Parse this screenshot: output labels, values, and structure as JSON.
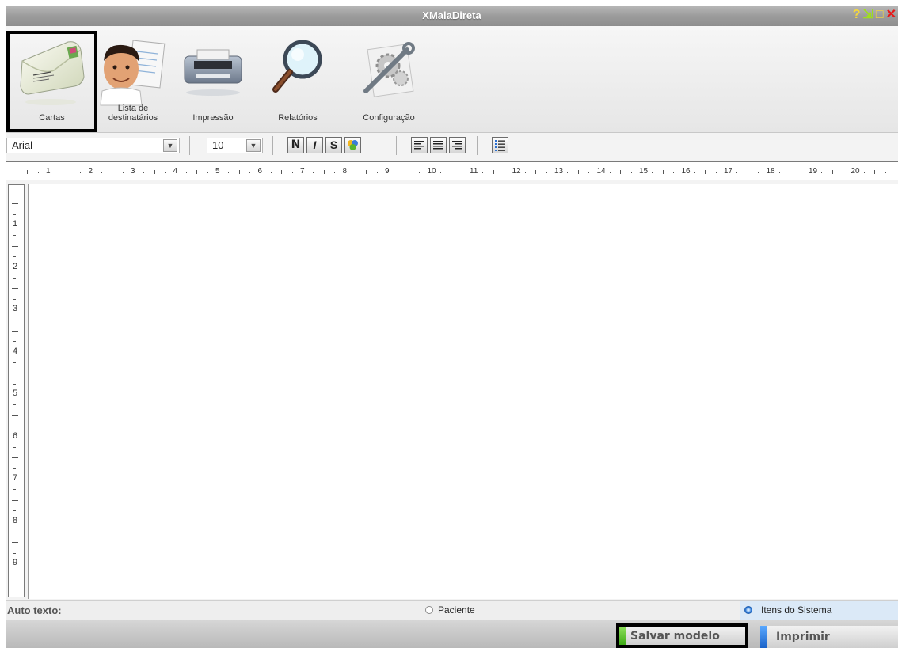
{
  "window": {
    "title": "XMalaDireta"
  },
  "ribbon": {
    "items": [
      {
        "label": "Cartas",
        "icon": "envelope-icon",
        "selected": true
      },
      {
        "label_line1": "Lista de",
        "label_line2": "destinatários",
        "icon": "person-list-icon"
      },
      {
        "label": "Impressão",
        "icon": "printer-icon"
      },
      {
        "label": "Relatórios",
        "icon": "magnifier-icon"
      },
      {
        "label": "Configuração",
        "icon": "tools-icon"
      }
    ]
  },
  "toolbar": {
    "font": "Arial",
    "size": "10",
    "bold_label": "N",
    "italic_label": "I",
    "underline_label": "S"
  },
  "ruler": {
    "marks": [
      "1",
      "2",
      "3",
      "4",
      "5",
      "6",
      "7",
      "8",
      "9",
      "10",
      "11",
      "12",
      "13",
      "14",
      "15",
      "16",
      "17",
      "18",
      "19",
      "20"
    ]
  },
  "vruler": {
    "marks": [
      "1",
      "2",
      "3",
      "4",
      "5",
      "6",
      "7",
      "8",
      "9"
    ]
  },
  "autotext": {
    "label": "Auto texto:",
    "option1": "Paciente",
    "option2": "Itens do Sistema",
    "selected": "Itens do Sistema"
  },
  "buttons": {
    "save": "Salvar modelo",
    "print": "Imprimir"
  },
  "colors": {
    "save_stripe": "#5fc82a",
    "print_stripe": "#2a7ee0",
    "close": "#e81919"
  }
}
